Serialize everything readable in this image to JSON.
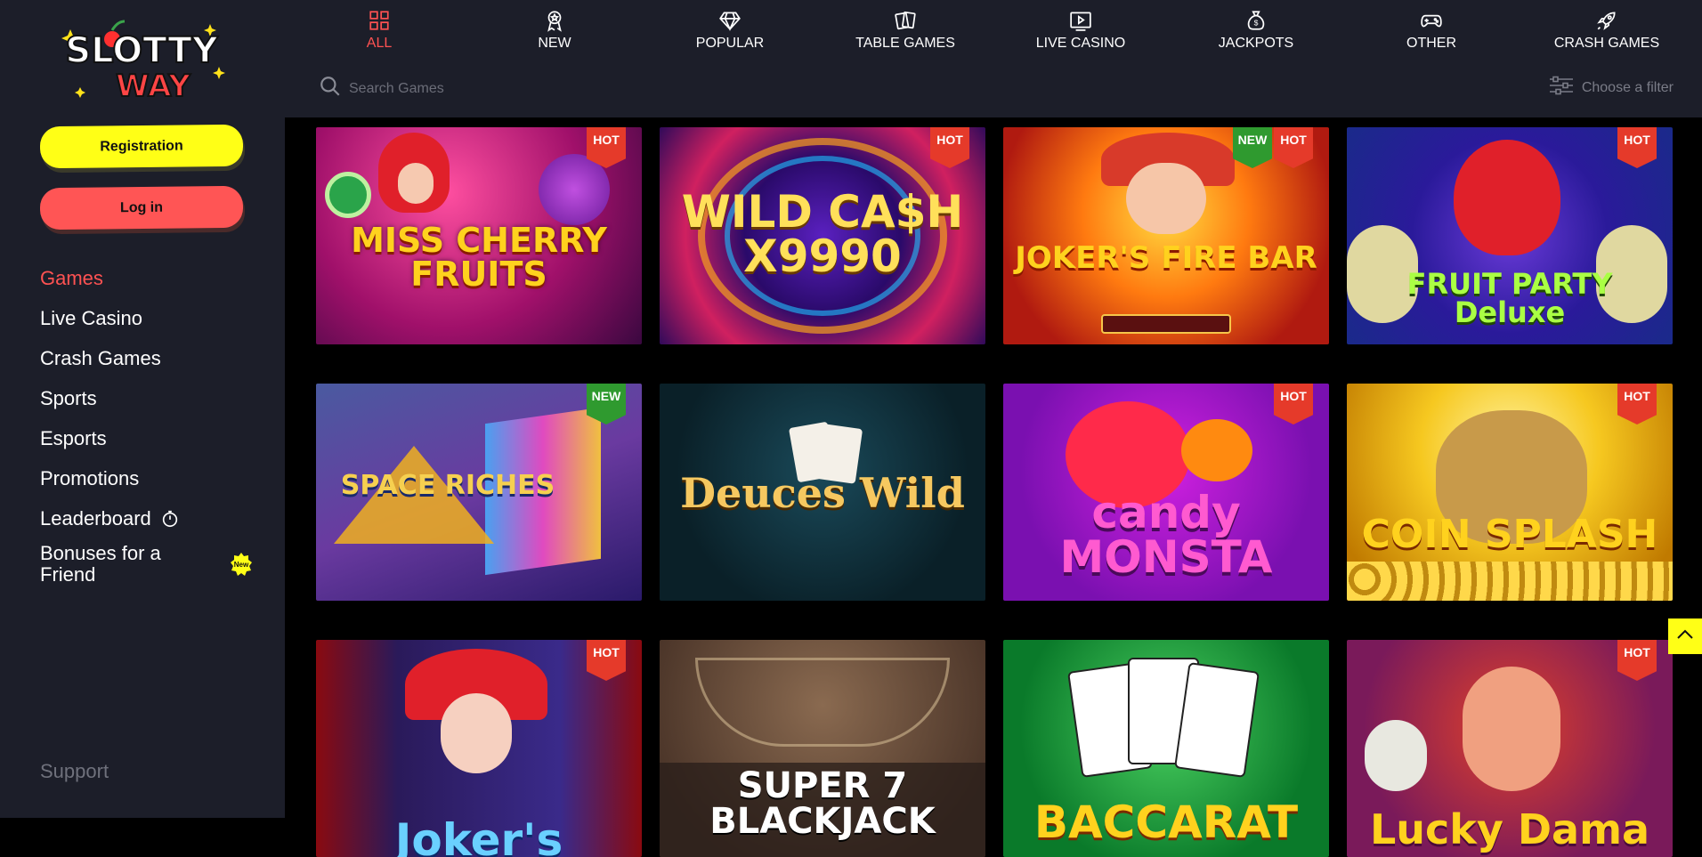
{
  "brand": {
    "logo_text_top": "SLOTTY",
    "logo_text_bottom": "WAY"
  },
  "sidebar": {
    "registration_label": "Registration",
    "login_label": "Log in",
    "items": [
      {
        "label": "Games",
        "active": true
      },
      {
        "label": "Live Casino"
      },
      {
        "label": "Crash Games"
      },
      {
        "label": "Sports"
      },
      {
        "label": "Esports"
      },
      {
        "label": "Promotions"
      },
      {
        "label": "Leaderboard",
        "icon": "stopwatch-icon"
      },
      {
        "label": "Bonuses for a Friend",
        "badge": "New"
      }
    ],
    "support_label": "Support"
  },
  "nav": {
    "tabs": [
      {
        "label": "ALL",
        "icon": "grid-icon",
        "active": true
      },
      {
        "label": "NEW",
        "icon": "medal-icon"
      },
      {
        "label": "POPULAR",
        "icon": "diamond-icon"
      },
      {
        "label": "TABLE GAMES",
        "icon": "cards-icon"
      },
      {
        "label": "LIVE CASINO",
        "icon": "live-screen-icon"
      },
      {
        "label": "JACKPOTS",
        "icon": "money-bag-icon"
      },
      {
        "label": "OTHER",
        "icon": "gamepad-icon"
      },
      {
        "label": "CRASH GAMES",
        "icon": "rocket-icon"
      }
    ],
    "search_placeholder": "Search Games",
    "filter_label": "Choose a filter"
  },
  "games": [
    {
      "title": "MISS CHERRY FRUITS",
      "badges": [
        "HOT"
      ]
    },
    {
      "title": "WILD CA$H X9990",
      "badges": [
        "HOT"
      ]
    },
    {
      "title": "JOKER'S FIRE BAR",
      "badges": [
        "NEW",
        "HOT"
      ]
    },
    {
      "title": "FRUIT PARTY Deluxe",
      "badges": [
        "HOT"
      ]
    },
    {
      "title": "SPACE RICHES",
      "badges": [
        "NEW"
      ]
    },
    {
      "title": "Deuces Wild",
      "badges": []
    },
    {
      "title": "candy MONSTA",
      "badges": [
        "HOT"
      ]
    },
    {
      "title": "COIN SPLASH",
      "badges": [
        "HOT"
      ]
    },
    {
      "title": "Joker's",
      "badges": [
        "HOT"
      ]
    },
    {
      "title": "SUPER 7 BLACKJACK",
      "badges": []
    },
    {
      "title": "BACCARAT",
      "badges": []
    },
    {
      "title": "Lucky Dama",
      "badges": [
        "HOT"
      ]
    }
  ],
  "colors": {
    "accent_red": "#ff5252",
    "accent_yellow": "#ffff16",
    "sidebar_bg": "#1c1e29"
  }
}
